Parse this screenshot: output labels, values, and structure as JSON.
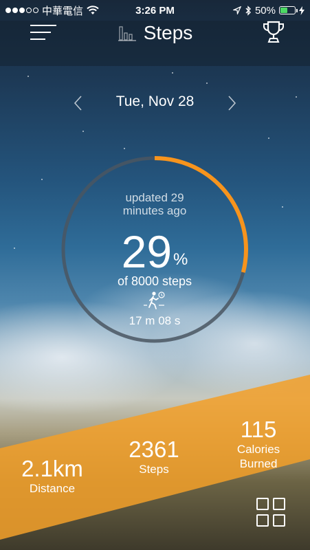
{
  "status": {
    "carrier": "中華電信",
    "time": "3:26 PM",
    "battery_percent": "50%",
    "battery_level": 0.5
  },
  "nav": {
    "title": "Steps"
  },
  "date": {
    "label": "Tue, Nov 28"
  },
  "progress": {
    "updated_text": "updated 29 minutes ago",
    "percent_value": "29",
    "percent_sign": "%",
    "fraction": 0.29,
    "goal_text": "of 8000 steps",
    "duration": "17 m 08 s"
  },
  "stats": {
    "distance_value": "2.1km",
    "distance_label": "Distance",
    "steps_value": "2361",
    "steps_label": "Steps",
    "calories_value": "115",
    "calories_label_1": "Calories",
    "calories_label_2": "Burned"
  },
  "colors": {
    "accent": "#f7941d",
    "ring_track": "#4a5662",
    "band": "#f2a02a"
  },
  "icons": [
    "menu-icon",
    "bar-chart-icon",
    "trophy-icon",
    "chevron-left-icon",
    "chevron-right-icon",
    "walking-person-icon",
    "grid-icon"
  ]
}
